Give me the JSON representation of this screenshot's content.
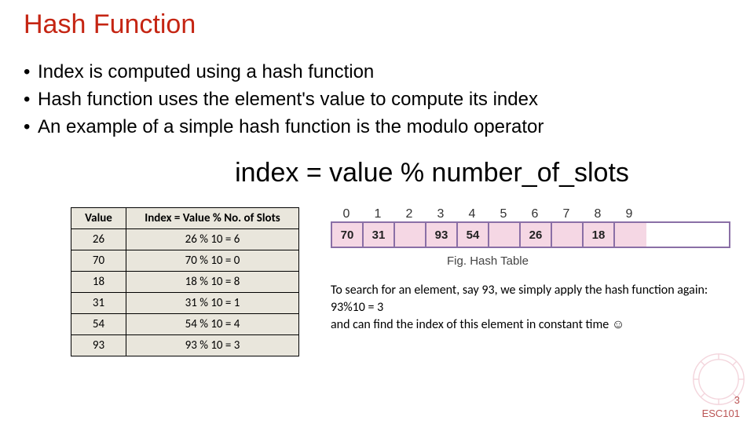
{
  "title": "Hash Function",
  "bullets": [
    "Index is computed using a hash function",
    "Hash function uses the element's value to compute its index",
    "An example of a simple hash function is the modulo operator"
  ],
  "formula": "index = value % number_of_slots",
  "table": {
    "headers": [
      "Value",
      "Index = Value % No. of Slots"
    ],
    "rows": [
      [
        "26",
        "26 % 10 = 6"
      ],
      [
        "70",
        "70 % 10 = 0"
      ],
      [
        "18",
        "18 % 10 = 8"
      ],
      [
        "31",
        "31 % 10 = 1"
      ],
      [
        "54",
        "54 % 10 = 4"
      ],
      [
        "93",
        "93 % 10 = 3"
      ]
    ]
  },
  "diagram": {
    "indices": [
      "0",
      "1",
      "2",
      "3",
      "4",
      "5",
      "6",
      "7",
      "8",
      "9"
    ],
    "cells": [
      "70",
      "31",
      "",
      "93",
      "54",
      "",
      "26",
      "",
      "18",
      ""
    ],
    "caption": "Fig. Hash Table"
  },
  "explain": "To search for an element, say 93, we simply apply the hash function again: 93%10 = 3\nand can find the index of this element in constant time ☺",
  "footer": {
    "page": "3",
    "course": "ESC101"
  }
}
